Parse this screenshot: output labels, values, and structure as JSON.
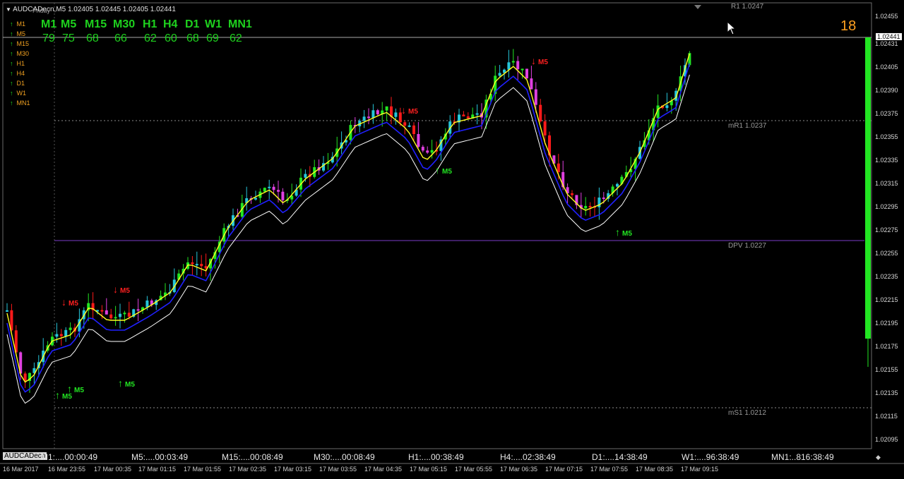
{
  "header": {
    "symbol_info": "AUDCADecn,M5  1.02405 1.02445 1.02405 1.02441",
    "friday": "Friday"
  },
  "timeframes": {
    "labels": [
      "M1",
      "M5",
      "M15",
      "M30",
      "H1",
      "H4",
      "D1",
      "W1",
      "MN1"
    ],
    "values": [
      "79",
      "75",
      "68",
      "66",
      "62",
      "60",
      "68",
      "69",
      "62"
    ]
  },
  "side_list": [
    "M1",
    "M5",
    "M15",
    "M30",
    "H1",
    "H4",
    "D1",
    "W1",
    "MN1"
  ],
  "counter": "18",
  "levels": {
    "r1": "R1 1.0247",
    "mr1": "mR1 1.0237",
    "dpv": "DPV 1.0227",
    "ms1": "mS1 1.0212"
  },
  "price_axis": [
    "1.02455",
    "1.02441",
    "1.02431",
    "1.02405",
    "1.02390",
    "1.02375",
    "1.02355",
    "1.02335",
    "1.02315",
    "1.02295",
    "1.02275",
    "1.02255",
    "1.02235",
    "1.02215",
    "1.02195",
    "1.02175",
    "1.02155",
    "1.02135",
    "1.02115",
    "1.02095"
  ],
  "tab_label": "AUDCADecn",
  "bottom_timers": [
    "M1:....00:00:49",
    "M5:....00:03:49",
    "M15:....00:08:49",
    "M30:....00:08:49",
    "H1:....00:38:49",
    "H4:....02:38:49",
    "D1:....14:38:49",
    "W1:....96:38:49",
    "MN1:..816:38:49"
  ],
  "time_axis": [
    "16 Mar 2017",
    "16 Mar 23:55",
    "17 Mar 00:35",
    "17 Mar 01:15",
    "17 Mar 01:55",
    "17 Mar 02:35",
    "17 Mar 03:15",
    "17 Mar 03:55",
    "17 Mar 04:35",
    "17 Mar 05:15",
    "17 Mar 05:55",
    "17 Mar 06:35",
    "17 Mar 07:15",
    "17 Mar 07:55",
    "17 Mar 08:35",
    "17 Mar 09:15"
  ],
  "signals": [
    {
      "dir": "down",
      "label": "M5"
    },
    {
      "dir": "down",
      "label": "M5"
    },
    {
      "dir": "up",
      "label": "M5"
    },
    {
      "dir": "up",
      "label": "M5"
    },
    {
      "dir": "up",
      "label": "M5"
    },
    {
      "dir": "down",
      "label": "M5"
    },
    {
      "dir": "up",
      "label": "M5"
    },
    {
      "dir": "down",
      "label": "M5"
    },
    {
      "dir": "up",
      "label": "M5"
    }
  ],
  "colors": {
    "bull_strong": "#22e622",
    "bull_weak": "#26c6da",
    "bear_strong": "#ff1a1a",
    "bear_weak": "#e040e0",
    "ma_fast": "#ffff20",
    "ma_mid": "#2020ff",
    "ma_slow": "#ffffff",
    "level_line": "#8c8c8c",
    "dpv_line": "#7a3cc8"
  }
}
